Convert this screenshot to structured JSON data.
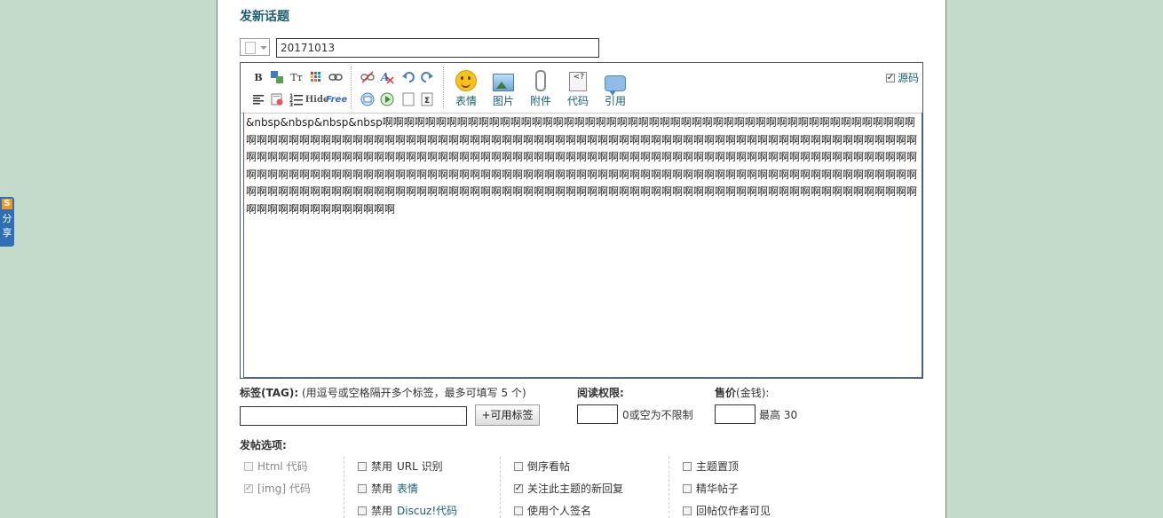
{
  "page": {
    "title": "发新话题",
    "subject_value": "20171013"
  },
  "toolbar": {
    "bold": "B",
    "font_size": "Tт",
    "hide": "Hide",
    "free": "Free",
    "big_buttons": [
      {
        "label": "表情",
        "icon": "smiley-icon"
      },
      {
        "label": "图片",
        "icon": "image-icon"
      },
      {
        "label": "附件",
        "icon": "paperclip-icon"
      },
      {
        "label": "代码",
        "icon": "code-icon"
      },
      {
        "label": "引用",
        "icon": "quote-icon"
      }
    ],
    "source_label": "源码",
    "source_checked": true
  },
  "editor": {
    "content": "&nbsp&nbsp&nbsp&nbsp啊啊啊啊啊啊啊啊啊啊啊啊啊啊啊啊啊啊啊啊啊啊啊啊啊啊啊啊啊啊啊啊啊啊啊啊啊啊啊啊啊啊啊啊啊啊啊啊啊啊啊啊啊啊啊啊啊啊啊啊啊啊啊啊啊啊啊啊啊啊啊啊啊啊啊啊啊啊啊啊啊啊啊啊啊啊啊啊啊啊啊啊啊啊啊啊啊啊啊啊啊啊啊啊啊啊啊啊啊啊啊啊啊啊啊啊啊啊啊啊啊啊啊啊啊啊啊啊啊啊啊啊啊啊啊啊啊啊啊啊啊啊啊啊啊啊啊啊啊啊啊啊啊啊啊啊啊啊啊啊啊啊啊啊啊啊啊啊啊啊啊啊啊啊啊啊啊啊啊啊啊啊啊啊啊啊啊啊啊啊啊啊啊啊啊啊啊啊啊啊啊啊啊啊啊啊啊啊啊啊啊啊啊啊啊啊啊啊啊啊啊啊啊啊啊啊啊啊啊啊啊啊啊啊啊啊啊啊啊啊啊啊啊啊啊啊啊啊啊啊啊啊啊啊啊啊啊啊啊啊啊啊啊啊啊啊啊啊啊啊啊啊啊啊啊啊啊啊啊啊啊啊啊啊啊啊啊啊啊啊啊啊啊啊啊啊啊啊啊啊啊啊啊啊啊啊啊啊啊啊啊啊啊啊啊啊"
  },
  "tags": {
    "label": "标签(TAG):",
    "hint": "(用逗号或空格隔开多个标签，最多可填写 5 个)",
    "button": "+可用标签",
    "value": ""
  },
  "read_perm": {
    "label": "阅读权限:",
    "hint": "0或空为不限制",
    "value": ""
  },
  "price": {
    "label": "售价",
    "unit": "(金钱):",
    "hint": "最高 30",
    "value": ""
  },
  "options": {
    "title": "发帖选项:",
    "col1": [
      {
        "label": "Html 代码",
        "checked": false,
        "disabled": true
      },
      {
        "label": "[img] 代码",
        "checked": true,
        "disabled": true
      }
    ],
    "col2": [
      {
        "prefix": "禁用",
        "label": "URL 识别",
        "checked": false,
        "link": false
      },
      {
        "prefix": "禁用",
        "label": "表情",
        "checked": false,
        "link": true
      },
      {
        "prefix": "禁用",
        "label": "Discuz!代码",
        "checked": false,
        "link": true
      }
    ],
    "col3": [
      {
        "label": "倒序看帖",
        "checked": false
      },
      {
        "label": "关注此主题的新回复",
        "checked": true
      },
      {
        "label": "使用个人签名",
        "checked": false
      }
    ],
    "col4": [
      {
        "label": "主题置顶",
        "checked": false
      },
      {
        "label": "精华帖子",
        "checked": false
      },
      {
        "label": "回帖仅作者可见",
        "checked": false
      }
    ]
  },
  "share": {
    "logo": "S",
    "label_1": "分",
    "label_2": "享"
  }
}
